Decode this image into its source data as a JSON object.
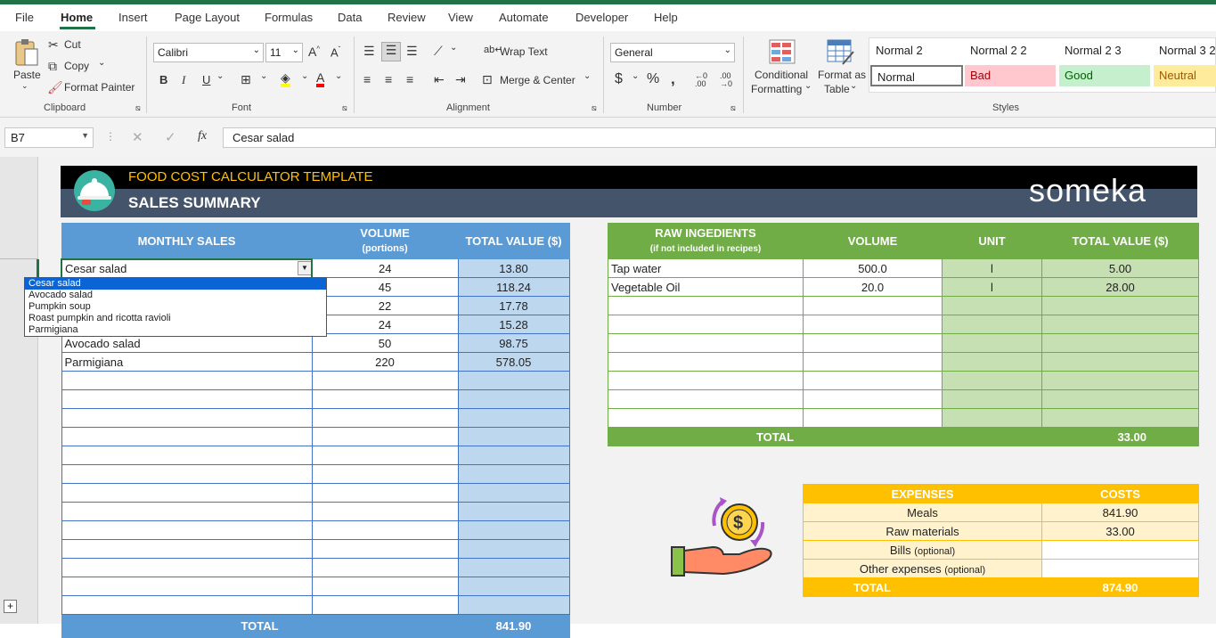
{
  "menu": {
    "tabs": [
      "File",
      "Home",
      "Insert",
      "Page Layout",
      "Formulas",
      "Data",
      "Review",
      "View",
      "Automate",
      "Developer",
      "Help"
    ],
    "active": "Home"
  },
  "ribbon": {
    "clipboard": {
      "paste": "Paste",
      "cut": "Cut",
      "copy": "Copy",
      "format_painter": "Format Painter",
      "label": "Clipboard"
    },
    "font": {
      "name": "Calibri",
      "size": "11",
      "label": "Font",
      "bold": "B",
      "italic": "I",
      "underline": "U"
    },
    "alignment": {
      "wrap": "Wrap Text",
      "merge": "Merge & Center",
      "label": "Alignment"
    },
    "number": {
      "format": "General",
      "label": "Number"
    },
    "styles": {
      "conditional": "Conditional",
      "conditional2": "Formatting",
      "format_as": "Format as",
      "format_as2": "Table",
      "label": "Styles",
      "cells": [
        {
          "name": "Normal 2"
        },
        {
          "name": "Normal 2 2"
        },
        {
          "name": "Normal 2 3"
        },
        {
          "name": "Normal 3 2"
        },
        {
          "name": "Normal"
        },
        {
          "name": "Bad"
        },
        {
          "name": "Good"
        },
        {
          "name": "Neutral"
        }
      ]
    }
  },
  "formula_bar": {
    "name_box": "B7",
    "content": "Cesar salad",
    "fx": "fx"
  },
  "banner": {
    "title": "FOOD COST CALCULATOR TEMPLATE",
    "subtitle": "SALES SUMMARY",
    "brand": "someka"
  },
  "sales": {
    "headers": {
      "item": "MONTHLY SALES",
      "volume": "VOLUME",
      "volume_sub": "(portions)",
      "total": "TOTAL VALUE ($)"
    },
    "rows": [
      {
        "item": "Cesar salad",
        "volume": "24",
        "total": "13.80"
      },
      {
        "item": "",
        "volume": "45",
        "total": "118.24"
      },
      {
        "item": "",
        "volume": "22",
        "total": "17.78"
      },
      {
        "item": "",
        "volume": "24",
        "total": "15.28"
      },
      {
        "item": "Avocado salad",
        "volume": "50",
        "total": "98.75"
      },
      {
        "item": "Parmigiana",
        "volume": "220",
        "total": "578.05"
      }
    ],
    "total_label": "TOTAL",
    "total_value": "841.90"
  },
  "dropdown": {
    "options": [
      "Cesar salad",
      "Avocado salad",
      "Pumpkin soup",
      "Roast pumpkin and ricotta ravioli",
      "Parmigiana"
    ],
    "selected": "Cesar salad"
  },
  "raw": {
    "headers": {
      "item": "RAW INGEDIENTS",
      "item_sub": "(if not included in recipes)",
      "volume": "VOLUME",
      "unit": "UNIT",
      "total": "TOTAL VALUE ($)"
    },
    "rows": [
      {
        "item": "Tap water",
        "volume": "500.0",
        "unit": "l",
        "total": "5.00"
      },
      {
        "item": "Vegetable Oil",
        "volume": "20.0",
        "unit": "l",
        "total": "28.00"
      }
    ],
    "total_label": "TOTAL",
    "total_value": "33.00"
  },
  "expenses": {
    "headers": {
      "item": "EXPENSES",
      "cost": "COSTS"
    },
    "rows": [
      {
        "item": "Meals",
        "note": "",
        "cost": "841.90"
      },
      {
        "item": "Raw materials",
        "note": "",
        "cost": "33.00"
      },
      {
        "item": "Bills ",
        "note": "(optional)",
        "cost": ""
      },
      {
        "item": "Other expenses ",
        "note": "(optional)",
        "cost": ""
      }
    ],
    "total_label": "TOTAL",
    "total_value": "874.90"
  },
  "colors": {
    "excel_green": "#217346",
    "blue_header": "#5b9bd5",
    "blue_fill": "#bdd7ee",
    "green_header": "#70ad47",
    "green_fill": "#c6e0b4",
    "orange_header": "#ffc000",
    "orange_fill": "#fff2cc",
    "banner_dark": "#44546a",
    "title_orange": "#ffc000"
  }
}
